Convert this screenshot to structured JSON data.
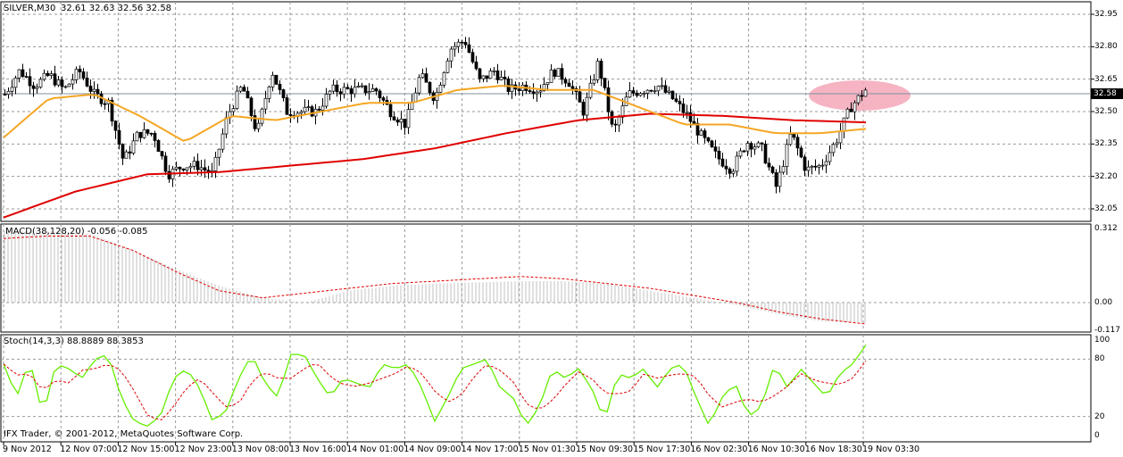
{
  "header": {
    "symbol": "SILVER,M30",
    "ohlc": "32.61 32.63 32.56 32.58"
  },
  "macd_label": "MACD(38,128,20) -0.056 -0.085",
  "stoch_label": "Stoch(14,3,3) 88.8889 88.3853",
  "copyright": "IFX Trader, © 2001-2012, MetaQuotes Software Corp.",
  "current_price": "32.58",
  "colors": {
    "fast_ma": "#f5a623",
    "slow_ma": "#e00000",
    "stoch_main": "#66ee00",
    "stoch_signal": "#e00000",
    "macd_hist": "#c0c0c0",
    "highlight": "#f4a7b9"
  },
  "chart_data": [
    {
      "type": "candlestick",
      "title": "SILVER,M30",
      "ylim": [
        32.0,
        32.98
      ],
      "price_ticks": [
        "32.95",
        "32.80",
        "32.65",
        "32.50",
        "32.35",
        "32.20",
        "32.05"
      ],
      "time_labels": [
        "9 Nov 2012",
        "12 Nov 07:00",
        "12 Nov 15:00",
        "12 Nov 23:00",
        "13 Nov 08:00",
        "13 Nov 16:00",
        "14 Nov 01:00",
        "14 Nov 09:00",
        "14 Nov 17:00",
        "15 Nov 01:30",
        "15 Nov 09:30",
        "15 Nov 17:30",
        "16 Nov 02:30",
        "16 Nov 10:30",
        "16 Nov 18:30",
        "19 Nov 03:30"
      ],
      "close_path": [
        32.58,
        32.69,
        32.62,
        32.67,
        32.6,
        32.69,
        32.58,
        32.54,
        32.27,
        32.4,
        32.4,
        32.21,
        32.25,
        32.25,
        32.21,
        32.48,
        32.62,
        32.4,
        32.69,
        32.5,
        32.5,
        32.5,
        32.6,
        32.6,
        32.6,
        32.6,
        32.5,
        32.44,
        32.67,
        32.56,
        32.79,
        32.83,
        32.64,
        32.69,
        32.6,
        32.62,
        32.6,
        32.69,
        32.64,
        32.5,
        32.73,
        32.4,
        32.58,
        32.6,
        32.62,
        32.56,
        32.48,
        32.38,
        32.29,
        32.23,
        32.36,
        32.33,
        32.15,
        32.4,
        32.23,
        32.25,
        32.36,
        32.52,
        32.6
      ],
      "fast_ma": [
        32.38,
        32.56,
        32.58,
        32.48,
        32.36,
        32.48,
        32.46,
        32.5,
        32.54,
        32.54,
        32.6,
        32.62,
        32.6,
        32.6,
        32.52,
        32.44,
        32.44,
        32.4,
        32.4,
        32.42
      ],
      "slow_ma": [
        32.01,
        32.13,
        32.21,
        32.22,
        32.25,
        32.28,
        32.33,
        32.4,
        32.46,
        32.49,
        32.48,
        32.46,
        32.45
      ]
    },
    {
      "type": "macd",
      "ylim": [
        -0.117,
        0.312
      ],
      "ticks": [
        "0.312",
        "0.00",
        "-0.117"
      ],
      "histogram": [
        0.3,
        0.3,
        0.29,
        0.22,
        0.14,
        0.07,
        0.02,
        0.0,
        0.05,
        0.07,
        0.08,
        0.085,
        0.09,
        0.09,
        0.08,
        0.05,
        0.02,
        -0.01,
        -0.05,
        -0.08,
        -0.085
      ],
      "signal": [
        0.27,
        0.28,
        0.28,
        0.22,
        0.13,
        0.05,
        0.02,
        0.04,
        0.06,
        0.08,
        0.09,
        0.1,
        0.11,
        0.1,
        0.08,
        0.06,
        0.03,
        0.0,
        -0.04,
        -0.07,
        -0.09
      ]
    },
    {
      "type": "stochastic",
      "ylim": [
        0,
        100
      ],
      "ticks": [
        "100",
        "80",
        "20",
        "0"
      ],
      "levels": [
        80,
        20
      ],
      "main": [
        75,
        40,
        80,
        20,
        75,
        70,
        60,
        80,
        85,
        40,
        15,
        10,
        20,
        60,
        70,
        50,
        15,
        25,
        60,
        85,
        55,
        40,
        85,
        85,
        60,
        40,
        60,
        55,
        50,
        75,
        70,
        75,
        50,
        15,
        40,
        70,
        75,
        80,
        50,
        40,
        10,
        30,
        70,
        60,
        70,
        50,
        15,
        65,
        60,
        70,
        50,
        70,
        75,
        40,
        10,
        40,
        55,
        20,
        30,
        75,
        50,
        70,
        55,
        40,
        65,
        75,
        95
      ]
    }
  ]
}
